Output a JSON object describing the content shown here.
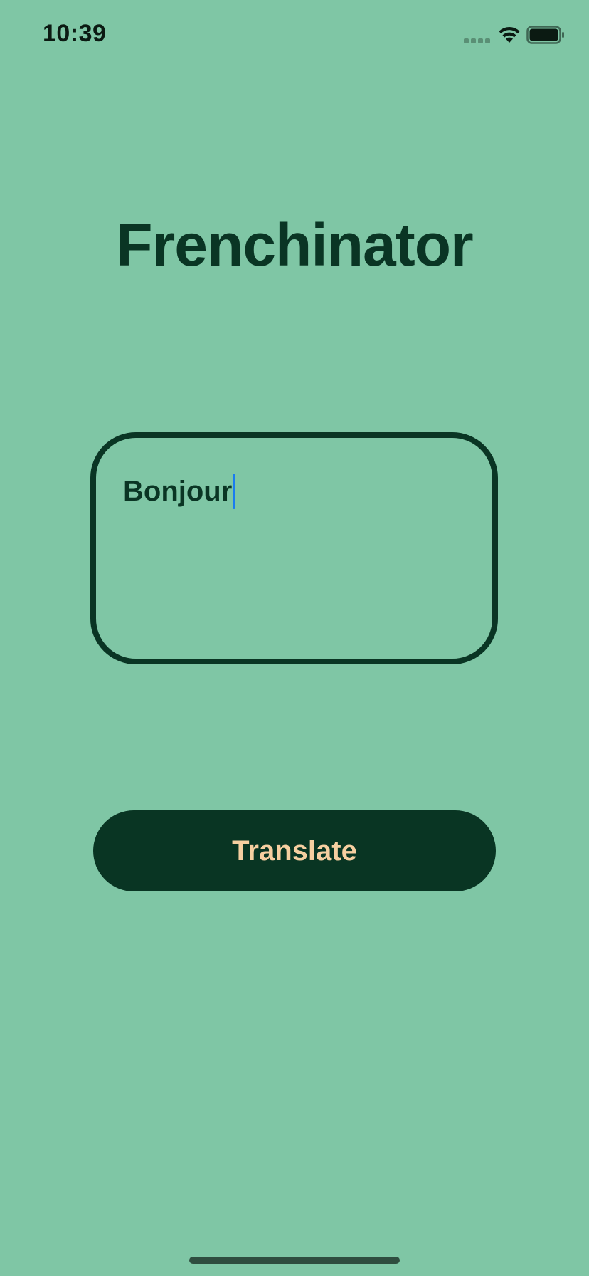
{
  "status_bar": {
    "time": "10:39",
    "icons": [
      "cellular-signal-icon",
      "wifi-icon",
      "battery-icon"
    ]
  },
  "app": {
    "title": "Frenchinator"
  },
  "input": {
    "value": "Bonjour"
  },
  "actions": {
    "translate_label": "Translate"
  },
  "colors": {
    "background": "#7fc6a5",
    "primary_dark": "#0a3524",
    "button_text": "#f6cfa0",
    "caret": "#1a7cf0"
  }
}
